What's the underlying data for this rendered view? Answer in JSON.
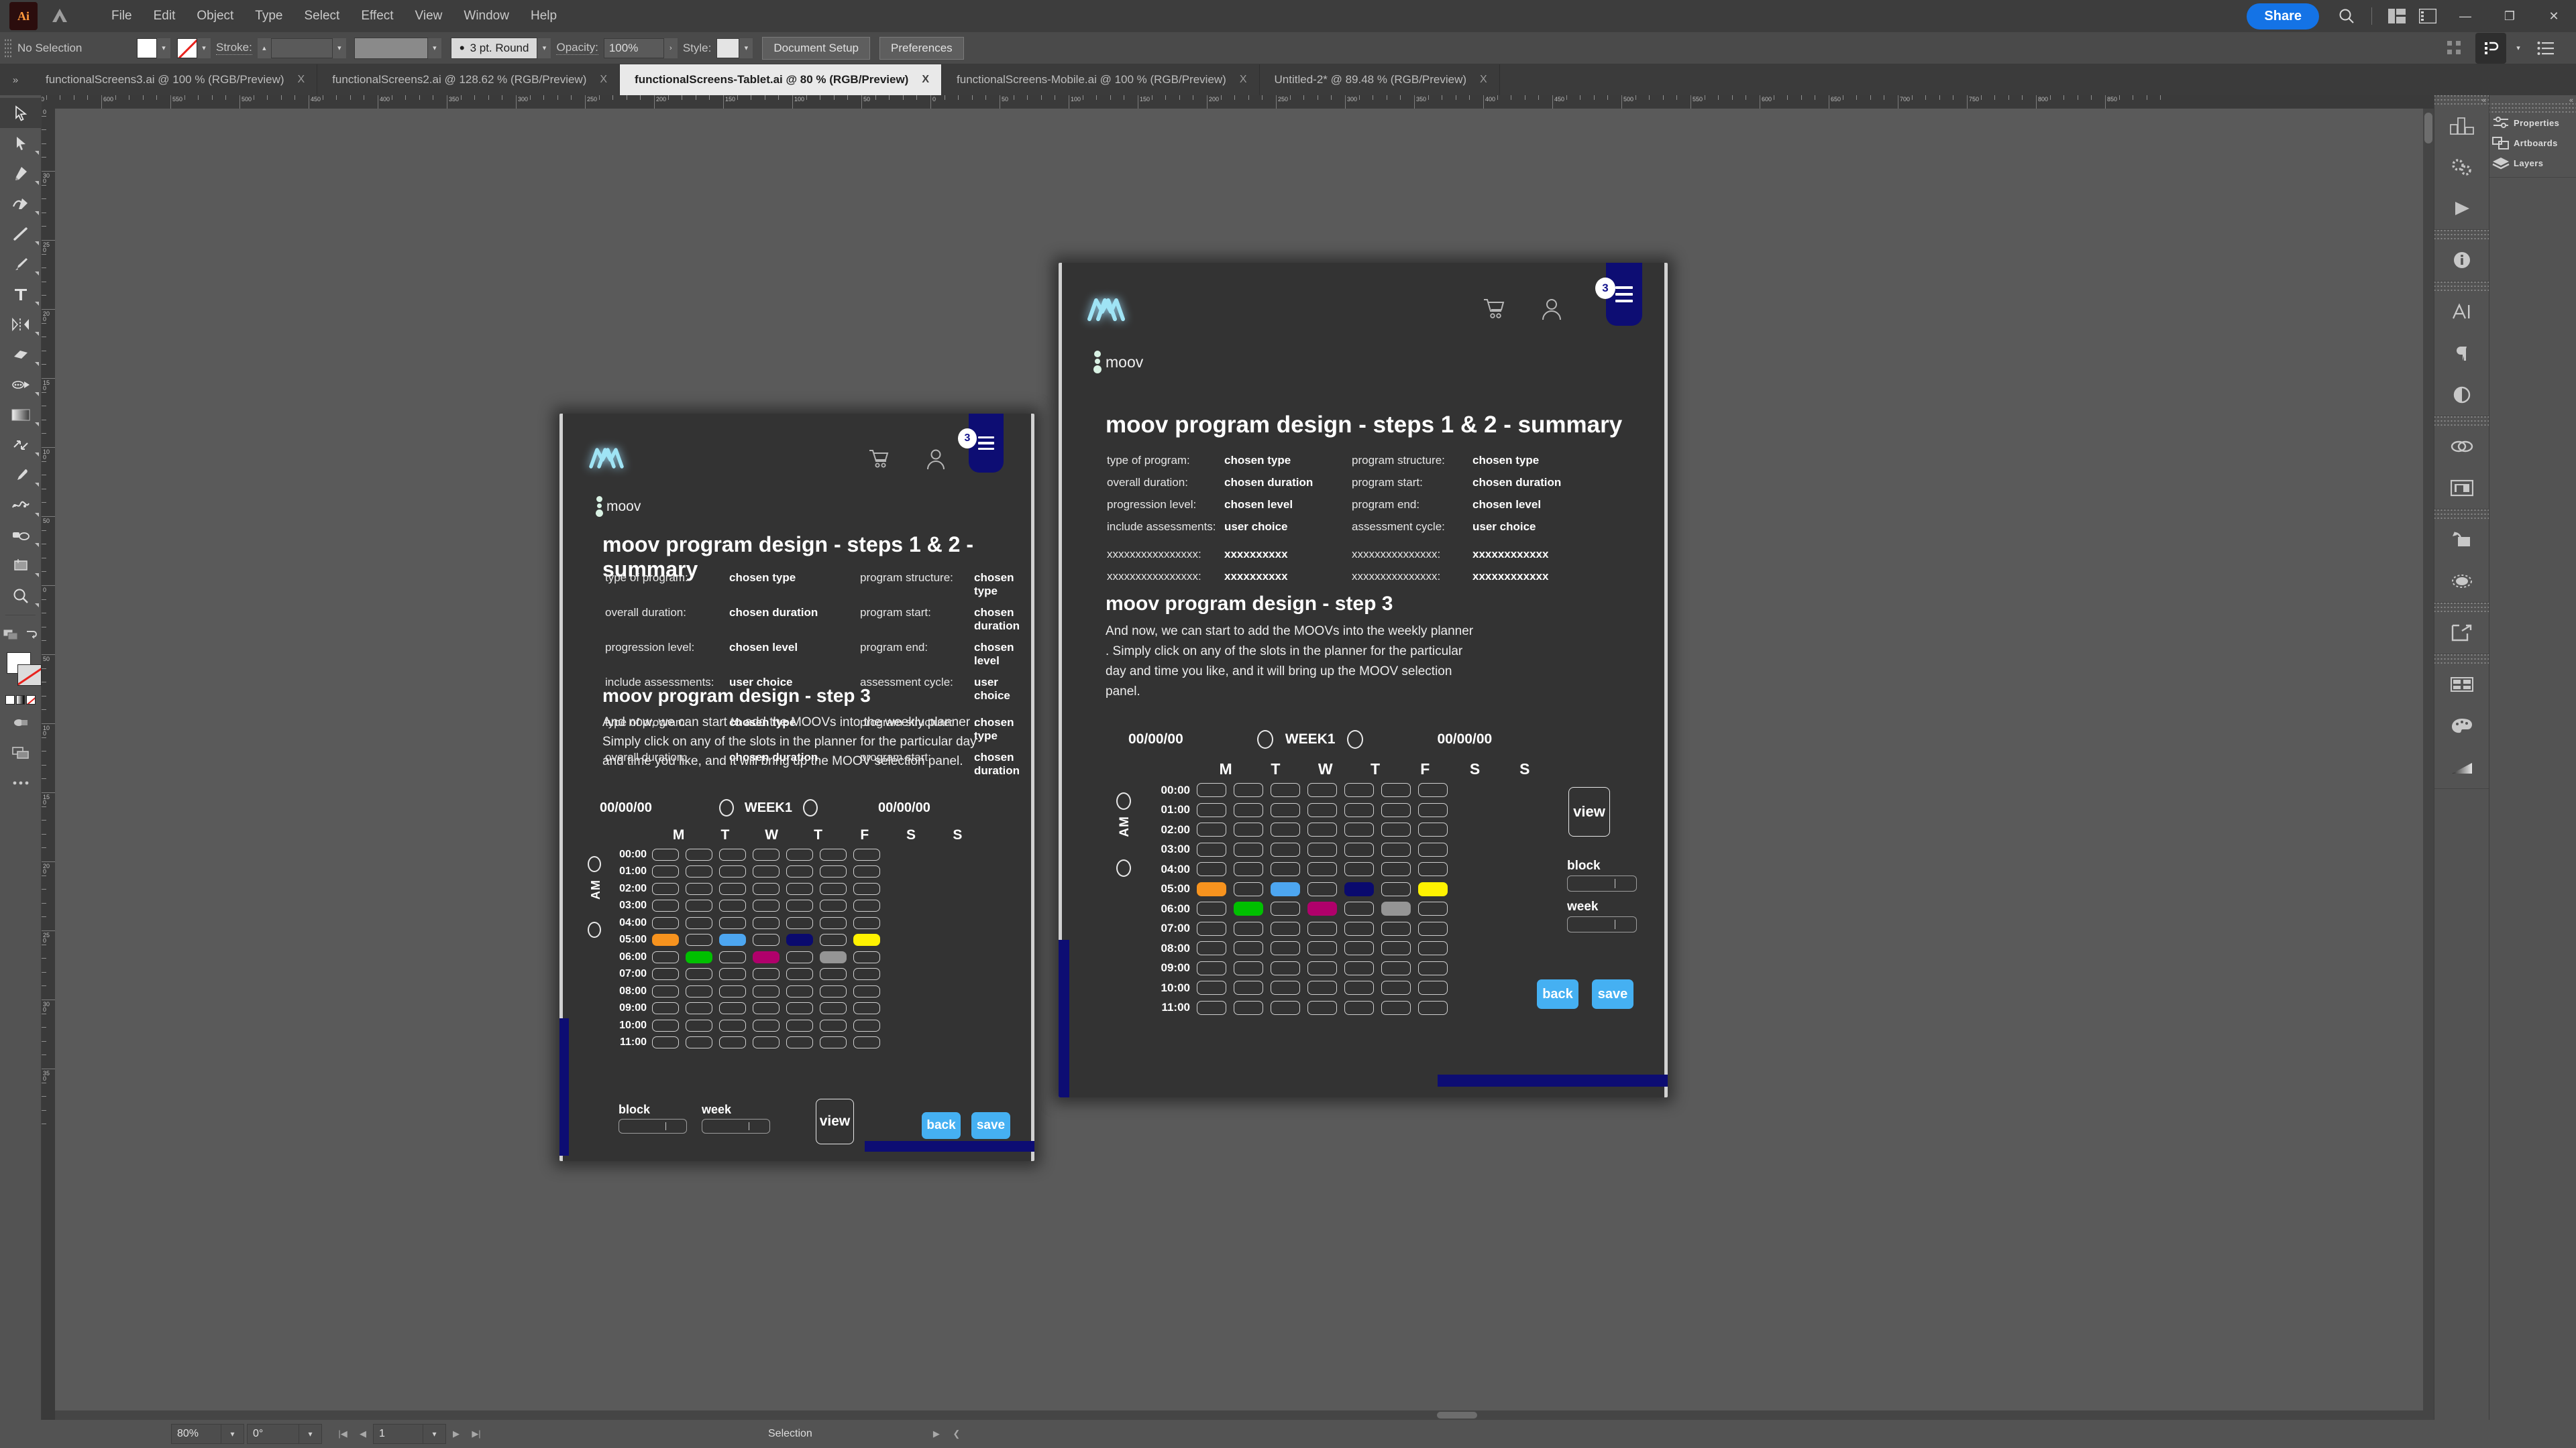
{
  "app": {
    "name": "Ai",
    "menu": [
      "File",
      "Edit",
      "Object",
      "Type",
      "Select",
      "Effect",
      "View",
      "Window",
      "Help"
    ],
    "share_label": "Share"
  },
  "control_bar": {
    "selection_state": "No Selection",
    "stroke_label": "Stroke:",
    "stroke_profile": "3 pt. Round",
    "opacity_label": "Opacity:",
    "opacity_value": "100%",
    "style_label": "Style:",
    "document_setup": "Document Setup",
    "preferences": "Preferences"
  },
  "tabs": [
    {
      "label": "functionalScreens3.ai @ 100 % (RGB/Preview)",
      "close": "X",
      "active": false
    },
    {
      "label": "functionalScreens2.ai @ 128.62 % (RGB/Preview)",
      "close": "X",
      "active": false
    },
    {
      "label": "functionalScreens-Tablet.ai @ 80 % (RGB/Preview)",
      "close": "X",
      "active": true
    },
    {
      "label": "functionalScreens-Mobile.ai @ 100 % (RGB/Preview)",
      "close": "X",
      "active": false
    },
    {
      "label": "Untitled-2* @ 89.48 % (RGB/Preview)",
      "close": "X",
      "active": false
    }
  ],
  "rulers": {
    "h_labels": [
      "650",
      "600",
      "550",
      "500",
      "450",
      "400",
      "350",
      "300",
      "250",
      "200",
      "150",
      "100",
      "50",
      "0",
      "50",
      "100",
      "150",
      "200",
      "250",
      "300",
      "350",
      "400",
      "450",
      "500",
      "550",
      "600",
      "650",
      "700",
      "750",
      "800",
      "850"
    ],
    "v_labels": [
      "350",
      "300",
      "250",
      "200",
      "150",
      "100",
      "50",
      "0",
      "50",
      "100",
      "150",
      "200",
      "250",
      "300",
      "350"
    ]
  },
  "right_dock": {
    "panels": [
      {
        "label": "Properties",
        "icon": "sliders-icon"
      },
      {
        "label": "Artboards",
        "icon": "artboards-icon"
      },
      {
        "label": "Layers",
        "icon": "layers-icon"
      }
    ],
    "icon_groups": [
      [
        "chart-icon",
        "gears-icon",
        "play-icon"
      ],
      [
        "info-icon"
      ],
      [
        "character-icon",
        "paragraph-icon",
        "opacity-icon"
      ],
      [
        "link-icon",
        "image-icon"
      ],
      [
        "transform-icon",
        "pathfinder-icon"
      ],
      [
        "export-icon"
      ],
      [
        "swatches-icon",
        "color-palette-icon",
        "gradient-icon"
      ]
    ]
  },
  "tools": [
    "selection-tool",
    "direct-selection-tool",
    "pen-tool",
    "curvature-tool",
    "line-tool",
    "paintbrush-tool",
    "type-tool",
    "shape-builder-tool",
    "eraser-tool",
    "width-tool",
    "gradient-tool",
    "rotate-tool",
    "eyedropper-tool",
    "blend-tool",
    "symbol-sprayer-tool",
    "artboard-tool",
    "zoom-tool"
  ],
  "status_bar": {
    "zoom": "80%",
    "rotation": "0°",
    "artboard_number": "1",
    "mode": "Selection"
  },
  "mockup": {
    "logo": "moov-logo",
    "cart_icon": "cart-icon",
    "account_icon": "account-icon",
    "menu_icon": "hamburger-icon",
    "badge": "3",
    "moov_label": "moov",
    "summary_title": "moov program design - steps 1 & 2 - summary",
    "summary_left": [
      {
        "key": "type of program:",
        "value": "chosen type"
      },
      {
        "key": "overall duration:",
        "value": "chosen duration"
      },
      {
        "key": "progression level:",
        "value": "chosen level"
      },
      {
        "key": "include assessments:",
        "value": "user choice"
      },
      {
        "key": "xxxxxxxxxxxxxxxx:",
        "value": "xxxxxxxxxx"
      },
      {
        "key": "xxxxxxxxxxxxxxxx:",
        "value": "xxxxxxxxxx"
      }
    ],
    "summary_right": [
      {
        "key": "program structure:",
        "value": "chosen type"
      },
      {
        "key": "program start:",
        "value": "chosen duration"
      },
      {
        "key": "program end:",
        "value": "chosen level"
      },
      {
        "key": "assessment cycle:",
        "value": "user choice"
      },
      {
        "key": "xxxxxxxxxxxxxxx:",
        "value": "xxxxxxxxxxxx"
      },
      {
        "key": "xxxxxxxxxxxxxxx:",
        "value": "xxxxxxxxxxxx"
      }
    ],
    "mobile_summary_left": [
      {
        "key": "type of program:",
        "value": "chosen type"
      },
      {
        "key": "overall duration:",
        "value": "chosen duration"
      },
      {
        "key": "progression level:",
        "value": "chosen level"
      },
      {
        "key": "include assessments:",
        "value": "user choice"
      },
      {
        "key": "type of program:",
        "value": "chosen type"
      },
      {
        "key": "overall duration:",
        "value": "chosen duration"
      }
    ],
    "mobile_summary_right": [
      {
        "key": "program structure:",
        "value": "chosen type"
      },
      {
        "key": "program start:",
        "value": "chosen duration"
      },
      {
        "key": "program end:",
        "value": "chosen level"
      },
      {
        "key": "assessment cycle:",
        "value": "user choice"
      },
      {
        "key": "program structure:",
        "value": "chosen type"
      },
      {
        "key": "program start:",
        "value": "chosen duration"
      }
    ],
    "step3_title": "moov program design - step 3",
    "step3_body": "And now, we can start to add the MOOVs into the weekly planner . Simply click on any of the slots in the planner for the particular day and time you like, and it will bring up the MOOV selection panel.",
    "planner": {
      "date_start": "00/00/00",
      "date_end": "00/00/00",
      "week_label": "WEEK1",
      "days": [
        "M",
        "T",
        "W",
        "T",
        "F",
        "S",
        "S"
      ],
      "times": [
        "00:00",
        "01:00",
        "02:00",
        "03:00",
        "04:00",
        "05:00",
        "06:00",
        "07:00",
        "08:00",
        "09:00",
        "10:00",
        "11:00"
      ],
      "ampm": "AM",
      "filled": [
        {
          "row": 5,
          "col": 0,
          "color": "#F7931E"
        },
        {
          "row": 5,
          "col": 2,
          "color": "#4DA6F0"
        },
        {
          "row": 5,
          "col": 4,
          "color": "#0A0A6E"
        },
        {
          "row": 5,
          "col": 6,
          "color": "#FFF200"
        },
        {
          "row": 6,
          "col": 1,
          "color": "#00C000"
        },
        {
          "row": 6,
          "col": 3,
          "color": "#B0006B"
        },
        {
          "row": 6,
          "col": 5,
          "color": "#959595"
        }
      ]
    },
    "view_label": "view",
    "block_label": "block",
    "week_field_label": "week",
    "back_label": "back",
    "save_label": "save"
  },
  "colors": {
    "accent_blue": "#1473e6",
    "mock_bg": "#333333",
    "navy": "#0d0d73",
    "button_blue": "#45b0f2"
  }
}
